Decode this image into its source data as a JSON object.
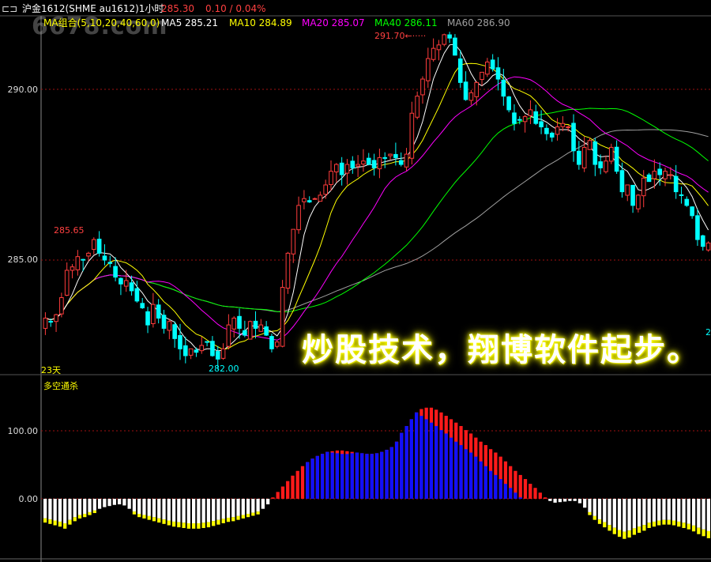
{
  "header": {
    "symbol_icon": "window-icon",
    "symbol": "沪金1612(SHME au1612)1小时",
    "price": "285.30",
    "change": "0.10 / 0.04%",
    "watermark": "6678.com"
  },
  "ma_legend": {
    "group": "MA组合(5,10,20,40,60,0)",
    "items": [
      {
        "label": "MA5 285.21",
        "color": "#ffffff"
      },
      {
        "label": "MA10 284.89",
        "color": "#ffff00"
      },
      {
        "label": "MA20 285.07",
        "color": "#ff00ff"
      },
      {
        "label": "MA40 286.11",
        "color": "#00ff00"
      },
      {
        "label": "MA60 286.90",
        "color": "#a0a0a0"
      }
    ]
  },
  "annotations": {
    "high": "291.70",
    "left_high": "285.65",
    "low": "282.00",
    "days": "23天",
    "right_edge_digit": "2"
  },
  "slogan": "炒股技术，翔博软件起步。",
  "indicator_panel": {
    "title": "多空通杀"
  },
  "colors": {
    "up": "#ff3c3c",
    "down": "#00ffff",
    "ref_line": "#a01010",
    "bull": "#ff1a1a",
    "bull_core": "#1010ff",
    "bear": "#ffffff",
    "bear_extra": "#ffff00"
  },
  "chart_data": [
    {
      "type": "candlestick",
      "title": "沪金1612(SHME au1612)1小时",
      "y_ticks": [
        "290.00",
        "285.00"
      ],
      "ylim": [
        280.0,
        293.0
      ],
      "closes": [
        283.3,
        283.2,
        283.4,
        283.9,
        284.7,
        284.8,
        285.1,
        285.0,
        285.2,
        285.6,
        285.2,
        285.0,
        284.9,
        284.5,
        284.3,
        284.4,
        284.1,
        283.8,
        283.6,
        283.1,
        283.7,
        283.3,
        283.0,
        283.2,
        282.7,
        282.4,
        282.2,
        282.4,
        282.3,
        282.5,
        282.6,
        282.2,
        282.1,
        282.4,
        283.1,
        283.3,
        283.0,
        282.8,
        283.2,
        283.0,
        283.1,
        282.8,
        282.4,
        282.6,
        284.2,
        285.2,
        285.9,
        286.6,
        286.8,
        286.7,
        286.8,
        286.9,
        287.2,
        287.6,
        287.8,
        287.5,
        287.8,
        287.7,
        287.8,
        287.9,
        287.8,
        287.7,
        288.0,
        288.0,
        288.1,
        288.0,
        287.8,
        288.1,
        289.3,
        289.8,
        290.3,
        290.9,
        291.2,
        291.3,
        291.6,
        291.5,
        291.0,
        290.2,
        289.7,
        289.9,
        290.2,
        290.5,
        290.8,
        290.6,
        290.3,
        289.8,
        289.4,
        289.0,
        289.1,
        289.2,
        289.4,
        289.0,
        288.9,
        288.7,
        288.6,
        288.9,
        289.0,
        288.9,
        288.2,
        287.8,
        288.3,
        288.5,
        287.8,
        287.7,
        287.9,
        288.3,
        287.6,
        287.0,
        287.2,
        286.6,
        286.9,
        287.4,
        287.3,
        287.6,
        287.5,
        287.6,
        287.5,
        287.0,
        286.9,
        286.6,
        286.3,
        285.6,
        285.4,
        285.5
      ],
      "high": 291.7,
      "low": 282.0,
      "moving_averages": [
        {
          "name": "MA5",
          "value": 285.21
        },
        {
          "name": "MA10",
          "value": 284.89
        },
        {
          "name": "MA20",
          "value": 285.07
        },
        {
          "name": "MA40",
          "value": 286.11
        },
        {
          "name": "MA60",
          "value": 286.9
        }
      ]
    },
    {
      "type": "bar",
      "title": "多空通杀",
      "y_ticks": [
        "100.00",
        "0.00"
      ],
      "ylim": [
        -75,
        155
      ],
      "values": [
        -35,
        -37,
        -39,
        -41,
        -44,
        -38,
        -33,
        -29,
        -27,
        -24,
        -21,
        -18,
        -15,
        -13,
        -11,
        -10,
        -12,
        -18,
        -23,
        -27,
        -29,
        -31,
        -33,
        -35,
        -37,
        -39,
        -41,
        -42,
        -43,
        -44,
        -44,
        -44,
        -43,
        -42,
        -40,
        -38,
        -36,
        -34,
        -33,
        -31,
        -29,
        -27,
        -25,
        -23,
        -18,
        -10,
        2,
        10,
        18,
        26,
        34,
        41,
        48,
        54,
        59,
        63,
        66,
        69,
        70,
        71,
        71,
        70,
        69,
        68,
        67,
        66,
        66,
        67,
        69,
        72,
        76,
        84,
        97,
        107,
        117,
        127,
        132,
        134,
        134,
        131,
        127,
        122,
        117,
        112,
        107,
        101,
        96,
        90,
        84,
        79,
        73,
        68,
        62,
        55,
        48,
        41,
        35,
        29,
        22,
        16,
        9,
        2,
        -4,
        -7,
        -6,
        -5,
        -4,
        -4,
        -8,
        -16,
        -24,
        -31,
        -37,
        -42,
        -47,
        -52,
        -56,
        -59,
        -57,
        -53,
        -50,
        -47,
        -43,
        -41,
        -39,
        -38,
        -38,
        -39,
        -41,
        -43,
        -45,
        -48,
        -52,
        -55,
        -58
      ],
      "bull_core_values": [
        70,
        71,
        71,
        70,
        69,
        68,
        67,
        66,
        66,
        67,
        69,
        72,
        76,
        84,
        97,
        107,
        117,
        127,
        132,
        134,
        134,
        131,
        127,
        122,
        117,
        112,
        107,
        101,
        96,
        90,
        84,
        79,
        73,
        68,
        62,
        55,
        48,
        41,
        35,
        29,
        22,
        16,
        9,
        2
      ],
      "bull_core_start": 53
    }
  ]
}
